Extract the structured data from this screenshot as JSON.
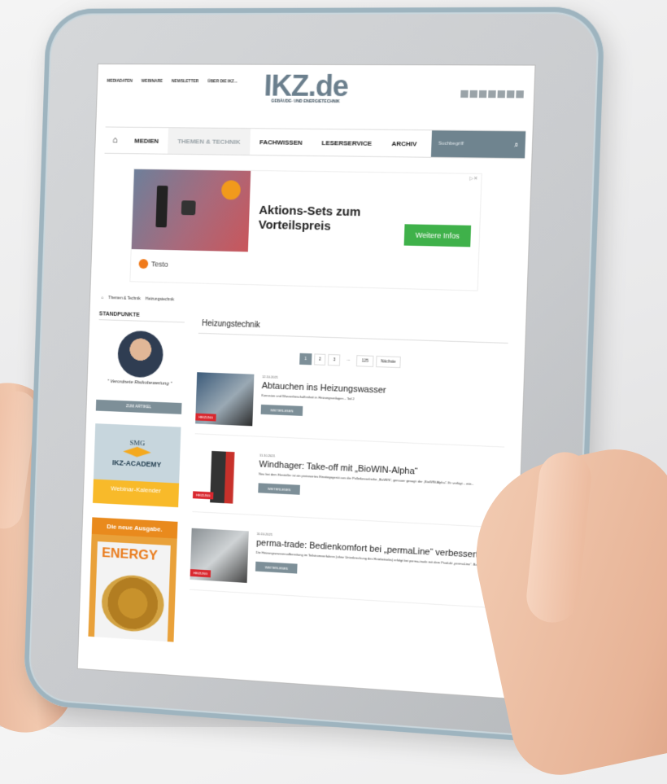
{
  "top_links": [
    "MEDIADATEN",
    "WEBINARE",
    "NEWSLETTER",
    "ÜBER DIE IKZ..."
  ],
  "logo": {
    "text": "IKZ.de",
    "tagline": "GEBÄUDE- UND ENERGIETECHNIK"
  },
  "nav": {
    "items": [
      "MEDIEN",
      "THEMEN & TECHNIK",
      "FACHWISSEN",
      "LESERSERVICE",
      "ARCHIV"
    ],
    "search_placeholder": "Suchbegriff"
  },
  "ad": {
    "headline": "Aktions-Sets zum Vorteilspreis",
    "button": "Weitere Infos",
    "brand": "Testo"
  },
  "breadcrumb": [
    "Themen & Technik",
    "Heizungstechnik"
  ],
  "sidebar": {
    "heading": "STANDPUNKTE",
    "quote": "\" Verordnete Risikobewertung \"",
    "button": "ZUM ARTIKEL",
    "banner1": {
      "smg": "SMG",
      "title": "IKZ-ACADEMY",
      "sub": "Webinar-Kalender"
    },
    "banner2": {
      "title": "Die neue Ausgabe.",
      "mag": "ENERGY"
    }
  },
  "main": {
    "title": "Heizungstechnik",
    "pager": [
      "1",
      "2",
      "3",
      "...",
      "125",
      "Nächste"
    ],
    "articles": [
      {
        "date": "12.10.2021",
        "title": "Abtauchen ins Heizungswasser",
        "text": "Korrosion und Wasserbeschaffenheit in Heizungsanlagen – Teil 2",
        "tag": "HEIZUNG",
        "more": "WEITERLESEN"
      },
      {
        "date": "11.10.2021",
        "title": "Windhager: Take-off mit „BioWIN-Alpha“",
        "text": "Neu bei dem Hersteller ist ein preiswertes Einstiegsgerät aus der Pelletkesselreihe „BioWIN“, genauer gesagt: der „BioWIN Alpha“. Er verfügt – wie...",
        "tag": "HEIZUNG",
        "more": "WEITERLESEN"
      },
      {
        "date": "10.10.2021",
        "title": "perma-trade: Bedienkomfort bei „permaLine“ verbessert",
        "text": "Die Heizungswasseraufbereitung im Teilstromverfahren (ohne Unterbrechung des Heizbetriebs) erfolgt bei perma-trade mit dem Produkt „permaLine“. Ba...",
        "tag": "HEIZUNG",
        "more": "WEITERLESEN"
      }
    ]
  },
  "colors": {
    "accent": "#6f848f",
    "ad_button": "#3fb14a",
    "tag": "#d9282f"
  }
}
